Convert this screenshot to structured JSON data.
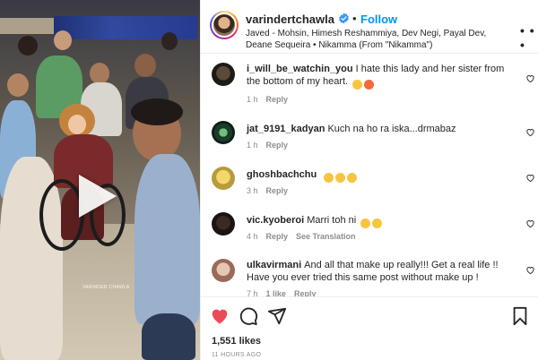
{
  "post": {
    "username": "varindertchawla",
    "follow_label": "Follow",
    "separator": "•",
    "audio_text": "Javed - Mohsin, Himesh Reshammiya, Dev Negi, Payal Dev, Deane Sequeira • Nikamma (From \"Nikamma\")",
    "more_label": "• • •",
    "video_watermark": "VARINDER CHAWLA"
  },
  "comments": [
    {
      "username": "i_will_be_watchin_you",
      "text": "I hate this lady and her sister from the bottom of my heart.",
      "emojis": [
        "😩",
        "😍"
      ],
      "time": "1 h",
      "reply_label": "Reply",
      "extra": ""
    },
    {
      "username": "jat_9191_kadyan",
      "text": "Kuch na ho ra iska...drmabaz",
      "emojis": [],
      "time": "1 h",
      "reply_label": "Reply",
      "extra": ""
    },
    {
      "username": "ghoshbachchu",
      "text": "",
      "emojis": [
        "😜",
        "🤣",
        "😂"
      ],
      "time": "3 h",
      "reply_label": "Reply",
      "extra": ""
    },
    {
      "username": "vic.kyoberoi",
      "text": "Marri toh ni",
      "emojis": [
        "😮",
        "😮"
      ],
      "time": "4 h",
      "reply_label": "Reply",
      "extra": "See Translation"
    },
    {
      "username": "ulkavirmani",
      "text": "And all that make up really!!! Get a real life !! Have you ever tried this same post without make up !",
      "emojis": [],
      "time": "7 h",
      "reply_label": "Reply",
      "extra": "1 like"
    }
  ],
  "footer": {
    "likes": "1,551 likes",
    "timestamp": "11 HOURS AGO"
  },
  "colors": {
    "accent": "#0095f6",
    "like_red": "#ed4956",
    "muted": "#8e8e8e"
  }
}
